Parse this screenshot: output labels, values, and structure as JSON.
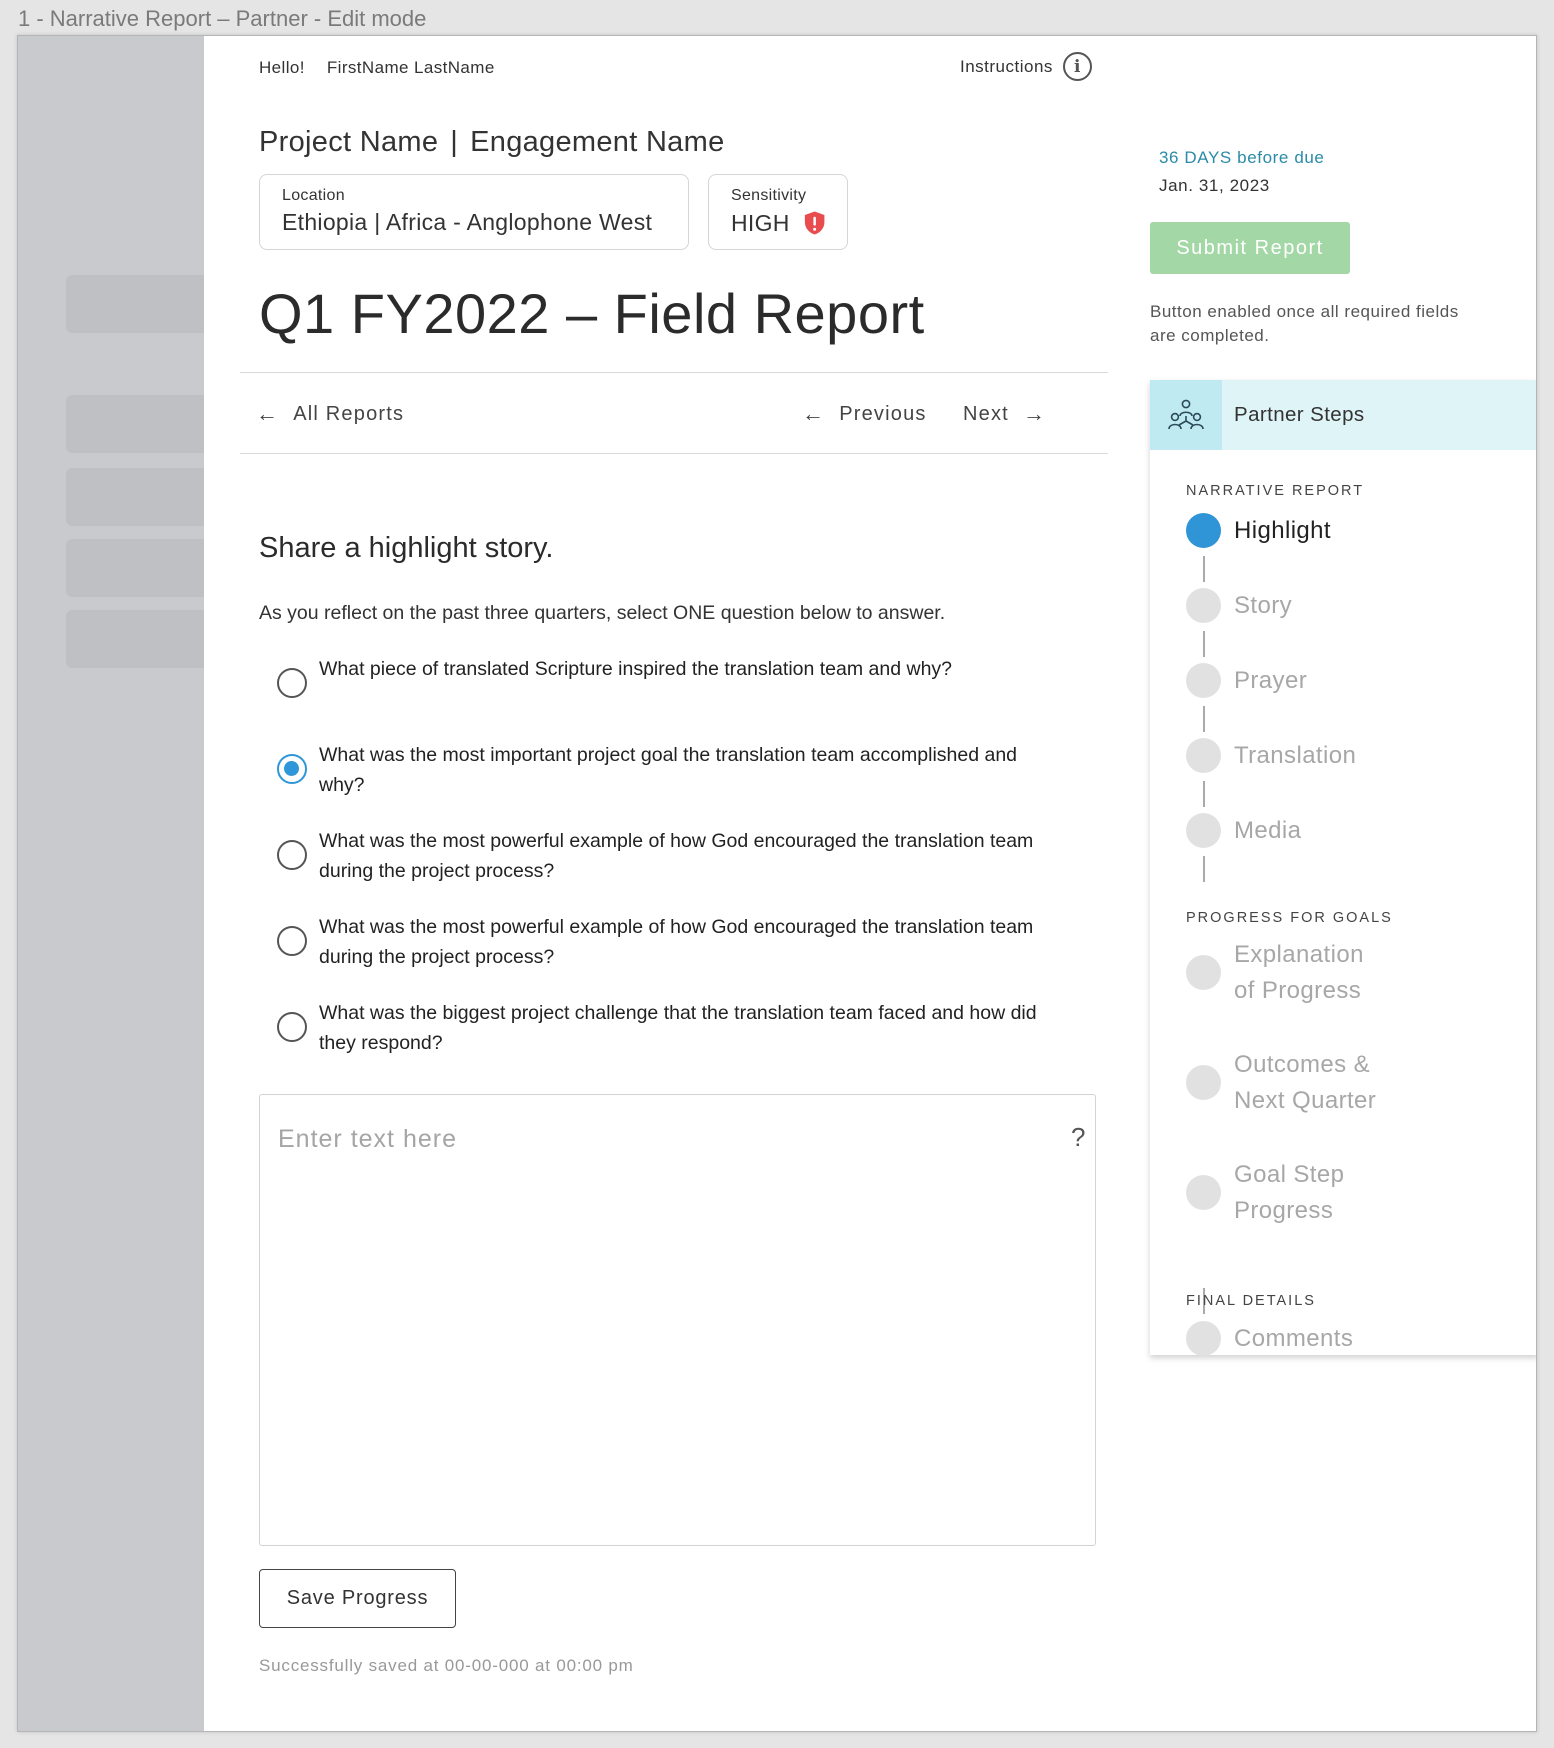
{
  "frame_label": "1 - Narrative Report – Partner - Edit mode",
  "header": {
    "greeting": "Hello!",
    "user_name": "FirstName LastName",
    "instructions_label": "Instructions"
  },
  "project": {
    "project_name": "Project Name",
    "separator": "|",
    "engagement_name": "Engagement Name",
    "location_label": "Location",
    "location_value": "Ethiopia | Africa - Anglophone West",
    "sensitivity_label": "Sensitivity",
    "sensitivity_value": "HIGH"
  },
  "report_title": "Q1 FY2022 – Field Report",
  "nav": {
    "all_reports": "All Reports",
    "previous": "Previous",
    "next": "Next"
  },
  "due": {
    "days": "36 DAYS before due",
    "date": "Jan. 31, 2023",
    "submit_label": "Submit Report",
    "submit_note": "Button enabled once all required fields are completed."
  },
  "question": {
    "heading": "Share a highlight story.",
    "instruction": "As you reflect on the past  three quarters, select ONE question below to answer.",
    "options": [
      {
        "text": "What piece of translated Scripture inspired the translation team and why?",
        "selected": false
      },
      {
        "text": "What was the most important project goal the translation team accomplished and why?",
        "selected": true
      },
      {
        "text": "What was the most powerful example of how God encouraged the translation team during the project process?",
        "selected": false
      },
      {
        "text": "What was the most powerful example of how God encouraged the translation team during the project process?",
        "selected": false
      },
      {
        "text": "What was the biggest project challenge that the translation team faced and how did they respond?",
        "selected": false
      }
    ],
    "answer_placeholder": "Enter text here",
    "answer_value": "",
    "help_icon": "?"
  },
  "save": {
    "label": "Save Progress",
    "status": "Successfully saved at 00-00-000 at 00:00 pm"
  },
  "steps_panel": {
    "title": "Partner Steps",
    "icon": "people-group-icon",
    "sections": [
      {
        "label": "NARRATIVE REPORT",
        "steps": [
          {
            "label": "Highlight",
            "active": true
          },
          {
            "label": "Story",
            "active": false
          },
          {
            "label": "Prayer",
            "active": false
          },
          {
            "label": "Translation",
            "active": false
          },
          {
            "label": "Media",
            "active": false
          }
        ]
      },
      {
        "label": "PROGRESS FOR GOALS",
        "steps": [
          {
            "label": "Explanation of Progress",
            "active": false
          },
          {
            "label": "Outcomes & Next Quarter",
            "active": false
          },
          {
            "label": "Goal Step Progress",
            "active": false
          }
        ]
      },
      {
        "label": "FINAL DETAILS",
        "steps": [
          {
            "label": "Comments",
            "active": false
          }
        ]
      }
    ]
  },
  "colors": {
    "accent_blue": "#2f95d6",
    "due_teal": "#2a8ba8",
    "submit_disabled_green": "#a3d8a6",
    "sensitivity_red": "#e84c4f",
    "steps_header_bg": "#dff4f7"
  }
}
